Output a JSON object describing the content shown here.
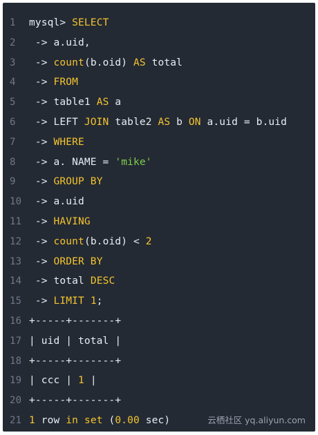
{
  "code": {
    "lines": [
      {
        "num": "1",
        "tokens": [
          {
            "t": "plain",
            "v": "mysql> "
          },
          {
            "t": "kw",
            "v": "SELECT"
          }
        ]
      },
      {
        "num": "2",
        "tokens": [
          {
            "t": "plain",
            "v": " -> a.uid,"
          }
        ]
      },
      {
        "num": "3",
        "tokens": [
          {
            "t": "plain",
            "v": " -> "
          },
          {
            "t": "kw",
            "v": "count"
          },
          {
            "t": "plain",
            "v": "(b.oid) "
          },
          {
            "t": "kw",
            "v": "AS"
          },
          {
            "t": "plain",
            "v": " total"
          }
        ]
      },
      {
        "num": "4",
        "tokens": [
          {
            "t": "plain",
            "v": " -> "
          },
          {
            "t": "kw",
            "v": "FROM"
          }
        ]
      },
      {
        "num": "5",
        "tokens": [
          {
            "t": "plain",
            "v": " -> table1 "
          },
          {
            "t": "kw",
            "v": "AS"
          },
          {
            "t": "plain",
            "v": " a"
          }
        ]
      },
      {
        "num": "6",
        "tokens": [
          {
            "t": "plain",
            "v": " -> LEFT "
          },
          {
            "t": "kw",
            "v": "JOIN"
          },
          {
            "t": "plain",
            "v": " table2 "
          },
          {
            "t": "kw",
            "v": "AS"
          },
          {
            "t": "plain",
            "v": " b "
          },
          {
            "t": "kw",
            "v": "ON"
          },
          {
            "t": "plain",
            "v": " a.uid = b.uid"
          }
        ]
      },
      {
        "num": "7",
        "tokens": [
          {
            "t": "plain",
            "v": " -> "
          },
          {
            "t": "kw",
            "v": "WHERE"
          }
        ]
      },
      {
        "num": "8",
        "tokens": [
          {
            "t": "plain",
            "v": " -> a. NAME = "
          },
          {
            "t": "str",
            "v": "'mike'"
          }
        ]
      },
      {
        "num": "9",
        "tokens": [
          {
            "t": "plain",
            "v": " -> "
          },
          {
            "t": "kw",
            "v": "GROUP BY"
          }
        ]
      },
      {
        "num": "10",
        "tokens": [
          {
            "t": "plain",
            "v": " -> a.uid"
          }
        ]
      },
      {
        "num": "11",
        "tokens": [
          {
            "t": "plain",
            "v": " -> "
          },
          {
            "t": "kw",
            "v": "HAVING"
          }
        ]
      },
      {
        "num": "12",
        "tokens": [
          {
            "t": "plain",
            "v": " -> "
          },
          {
            "t": "kw",
            "v": "count"
          },
          {
            "t": "plain",
            "v": "(b.oid) < "
          },
          {
            "t": "num",
            "v": "2"
          }
        ]
      },
      {
        "num": "13",
        "tokens": [
          {
            "t": "plain",
            "v": " -> "
          },
          {
            "t": "kw",
            "v": "ORDER BY"
          }
        ]
      },
      {
        "num": "14",
        "tokens": [
          {
            "t": "plain",
            "v": " -> total "
          },
          {
            "t": "kw",
            "v": "DESC"
          }
        ]
      },
      {
        "num": "15",
        "tokens": [
          {
            "t": "plain",
            "v": " -> "
          },
          {
            "t": "kw",
            "v": "LIMIT"
          },
          {
            "t": "plain",
            "v": " "
          },
          {
            "t": "num",
            "v": "1"
          },
          {
            "t": "plain",
            "v": ";"
          }
        ]
      },
      {
        "num": "16",
        "tokens": [
          {
            "t": "plain",
            "v": "+-----+-------+"
          }
        ]
      },
      {
        "num": "17",
        "tokens": [
          {
            "t": "plain",
            "v": "| uid | total |"
          }
        ]
      },
      {
        "num": "18",
        "tokens": [
          {
            "t": "plain",
            "v": "+-----+-------+"
          }
        ]
      },
      {
        "num": "19",
        "tokens": [
          {
            "t": "plain",
            "v": "| ccc | "
          },
          {
            "t": "num",
            "v": "1"
          },
          {
            "t": "plain",
            "v": " |"
          }
        ]
      },
      {
        "num": "20",
        "tokens": [
          {
            "t": "plain",
            "v": "+-----+-------+"
          }
        ]
      },
      {
        "num": "21",
        "tokens": [
          {
            "t": "num",
            "v": "1"
          },
          {
            "t": "plain",
            "v": " row "
          },
          {
            "t": "kw",
            "v": "in"
          },
          {
            "t": "plain",
            "v": " "
          },
          {
            "t": "kw",
            "v": "set"
          },
          {
            "t": "plain",
            "v": " ("
          },
          {
            "t": "num",
            "v": "0.00"
          },
          {
            "t": "plain",
            "v": " sec)"
          }
        ]
      }
    ]
  },
  "watermark": "云栖社区 yq.aliyun.com",
  "colors": {
    "background": "#242a33",
    "text": "#e9edf4",
    "keyword": "#f4c430",
    "string": "#7fcf4d",
    "line_number": "#70788a"
  }
}
